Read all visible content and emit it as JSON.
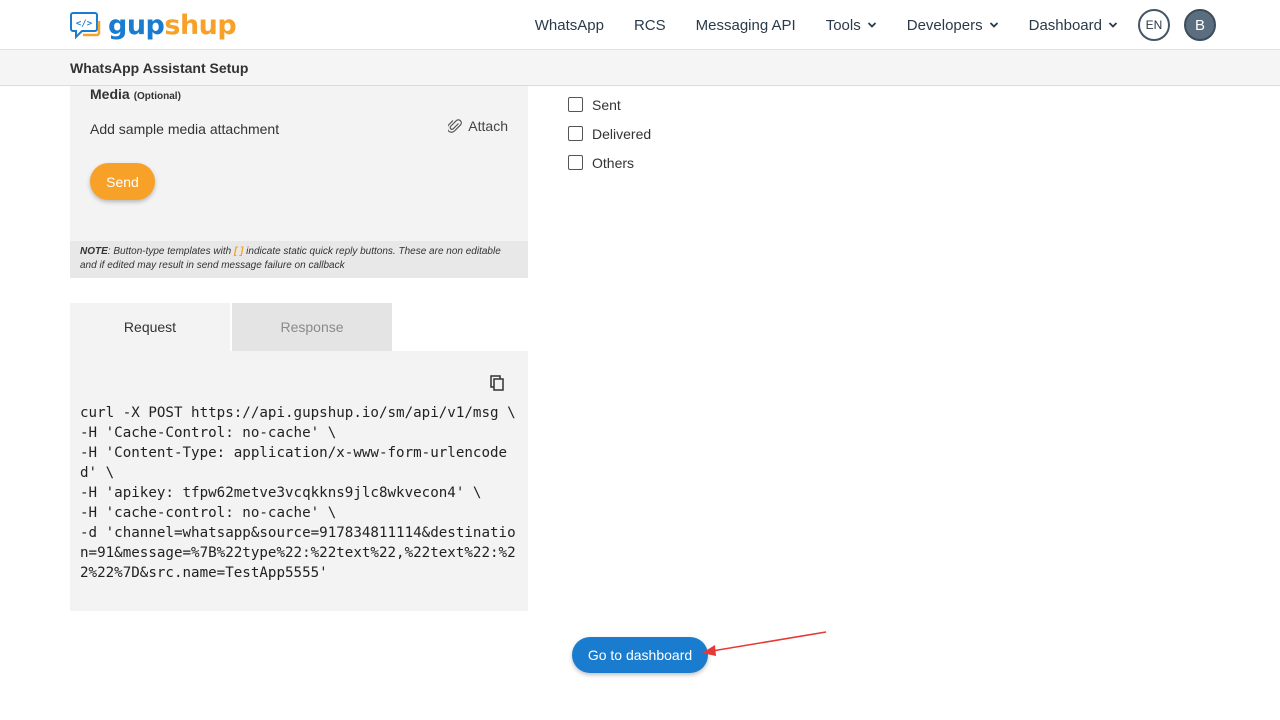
{
  "header": {
    "logo_text_part1": "gup",
    "logo_text_part2": "shup",
    "nav": [
      {
        "label": "WhatsApp",
        "dropdown": false
      },
      {
        "label": "RCS",
        "dropdown": false
      },
      {
        "label": "Messaging API",
        "dropdown": false
      },
      {
        "label": "Tools",
        "dropdown": true
      },
      {
        "label": "Developers",
        "dropdown": true
      },
      {
        "label": "Dashboard",
        "dropdown": true
      }
    ],
    "language": "EN",
    "avatar_initial": "B"
  },
  "subheader": {
    "title": "WhatsApp Assistant Setup"
  },
  "media": {
    "label": "Media",
    "optional": "(Optional)",
    "add_text": "Add sample media attachment",
    "attach_label": "Attach"
  },
  "send_label": "Send",
  "note": {
    "prefix": "NOTE",
    "text_before": ": Button-type templates with ",
    "bracket": "[ ]",
    "text_after": " indicate static quick reply buttons. These are non editable and if edited may result in send message failure on callback"
  },
  "tabs": {
    "request": "Request",
    "response": "Response"
  },
  "code": "curl -X POST https://api.gupshup.io/sm/api/v1/msg \\\n-H 'Cache-Control: no-cache' \\\n-H 'Content-Type: application/x-www-form-urlencoded' \\\n-H 'apikey: tfpw62metve3vcqkkns9jlc8wkvecon4' \\\n-H 'cache-control: no-cache' \\\n-d 'channel=whatsapp&source=917834811114&destination=91&message=%7B%22type%22:%22text%22,%22text%22:%22%22%7D&src.name=TestApp5555'",
  "status_checks": [
    {
      "label": "Sent",
      "checked": false
    },
    {
      "label": "Delivered",
      "checked": false
    },
    {
      "label": "Others",
      "checked": false
    }
  ],
  "go_dashboard_label": "Go to dashboard",
  "colors": {
    "brand_blue": "#1a7ccf",
    "brand_orange": "#f7a128",
    "annotation_arrow": "#e53935"
  }
}
